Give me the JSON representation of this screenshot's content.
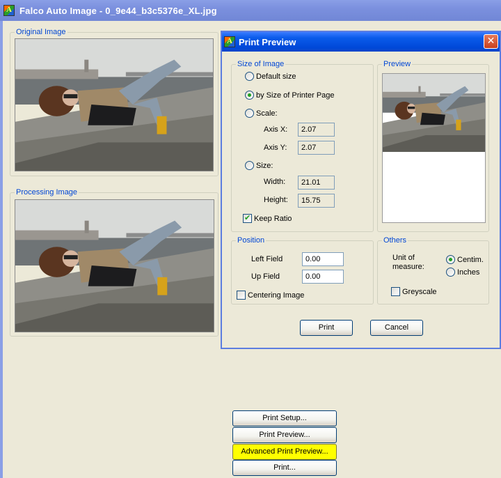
{
  "window": {
    "title": "Falco Auto Image - 0_9e44_b3c5376e_XL.jpg"
  },
  "original_group": {
    "label": "Original Image"
  },
  "processing_group": {
    "label": "Processing Image"
  },
  "dialog": {
    "title": "Print Preview",
    "close_label": "✕",
    "size_group": {
      "label": "Size of Image",
      "default_size": "Default size",
      "by_printer_page": "by Size of Printer Page",
      "scale": "Scale:",
      "axis_x_label": "Axis X:",
      "axis_x_value": "2.07",
      "axis_y_label": "Axis Y:",
      "axis_y_value": "2.07",
      "size": "Size:",
      "width_label": "Width:",
      "width_value": "21.01",
      "height_label": "Height:",
      "height_value": "15.75",
      "keep_ratio": "Keep Ratio",
      "selected": "by_printer_page",
      "keep_ratio_checked": true
    },
    "preview_group": {
      "label": "Preview"
    },
    "position_group": {
      "label": "Position",
      "left_field_label": "Left Field",
      "left_field_value": "0.00",
      "up_field_label": "Up Field",
      "up_field_value": "0.00",
      "centering": "Centering Image",
      "centering_checked": false
    },
    "others_group": {
      "label": "Others",
      "unit_label_line1": "Unit of",
      "unit_label_line2": "measure:",
      "centim": "Centim.",
      "inches": "Inches",
      "greyscale": "Greyscale",
      "unit_selected": "centim",
      "greyscale_checked": false
    },
    "print_button": "Print",
    "cancel_button": "Cancel"
  },
  "bottom_buttons": {
    "print_setup": "Print Setup...",
    "print_preview": "Print Preview...",
    "advanced_print_preview": "Advanced Print Preview...",
    "print": "Print..."
  },
  "colors": {
    "highlight": "#ffff00",
    "group_label": "#0046d5",
    "dialog_title": "#0a5bea"
  }
}
